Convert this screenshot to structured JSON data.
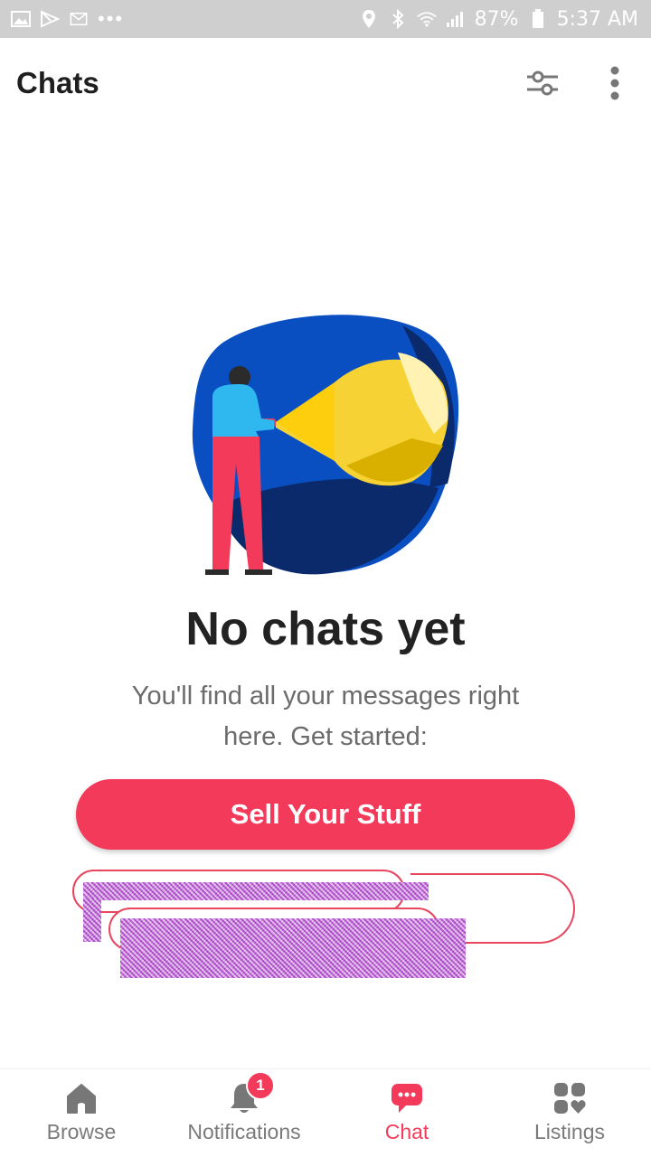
{
  "status_bar": {
    "battery": "87%",
    "time": "5:37 AM",
    "more_dots": "•••",
    "icons": [
      "image-icon",
      "play-store-icon",
      "gmail-icon",
      "location-icon",
      "bluetooth-icon",
      "wifi-icon",
      "signal-icon",
      "battery-icon"
    ]
  },
  "header": {
    "title": "Chats",
    "actions": [
      "filter-icon",
      "more-vert-icon"
    ]
  },
  "empty_state": {
    "title": "No chats yet",
    "message": "You'll find all your messages right here. Get started:",
    "primary_button": "Sell Your Stuff"
  },
  "bottom_nav": {
    "items": [
      {
        "label": "Browse",
        "icon": "home-icon"
      },
      {
        "label": "Notifications",
        "icon": "bell-icon",
        "badge": "1"
      },
      {
        "label": "Chat",
        "icon": "chat-icon",
        "active": true
      },
      {
        "label": "Listings",
        "icon": "listings-icon"
      }
    ]
  },
  "colors": {
    "accent": "#f43a5a",
    "status_bar": "#cfcfcf",
    "illustration_blue": "#0a4fc2",
    "illustration_navy": "#0a2a6b",
    "illustration_yellow": "#f7d234"
  }
}
